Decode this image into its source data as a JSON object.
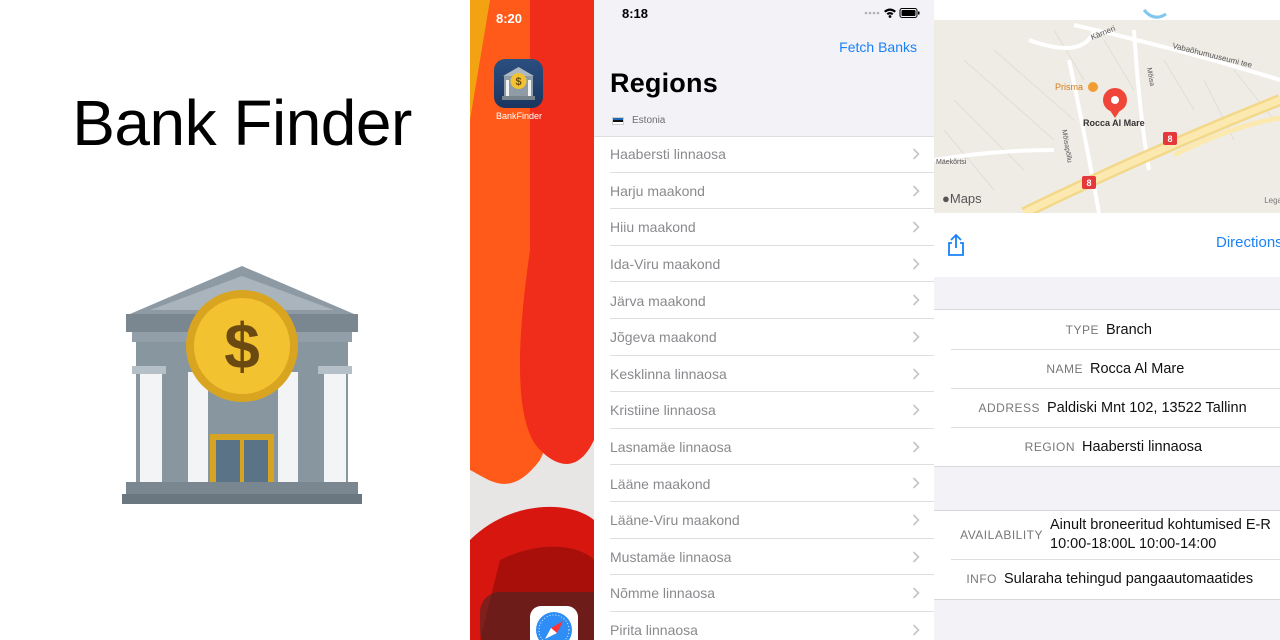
{
  "promo": {
    "title": "Bank Finder",
    "icon": "bank-dollar-icon"
  },
  "home": {
    "time": "8:20",
    "app_label": "BankFinder",
    "dock_app": "safari-icon"
  },
  "regions_screen": {
    "time": "8:18",
    "fetch_button": "Fetch Banks",
    "title": "Regions",
    "section_header": "Estonia",
    "items": [
      "Haabersti linnaosa",
      "Harju maakond",
      "Hiiu maakond",
      "Ida-Viru maakond",
      "Järva maakond",
      "Jõgeva maakond",
      "Kesklinna linnaosa",
      "Kristiine linnaosa",
      "Lasnamäe linnaosa",
      "Lääne maakond",
      "Lääne-Viru maakond",
      "Mustamäe linnaosa",
      "Nõmme linnaosa",
      "Pirita linnaosa"
    ]
  },
  "detail_screen": {
    "map": {
      "pin_label": "Rocca Al Mare",
      "poi_label": "Prisma",
      "streets": [
        "Kärneri",
        "Vabaõhumuuseumi tee",
        "Mõisa",
        "Mõisapõllu",
        "Mäekõrtsi"
      ],
      "road_badge": "8",
      "maps_logo": "Maps",
      "legal": "Lega"
    },
    "directions_button": "Directions",
    "share_icon": "share-icon",
    "rows": {
      "type": {
        "key": "TYPE",
        "value": "Branch"
      },
      "name": {
        "key": "NAME",
        "value": "Rocca Al Mare"
      },
      "address": {
        "key": "ADDRESS",
        "value": "Paldiski Mnt 102, 13522 Tallinn"
      },
      "region": {
        "key": "REGION",
        "value": "Haabersti linnaosa"
      },
      "availability": {
        "key": "AVAILABILITY",
        "value": "Ainult broneeritud kohtumised E-R  10:00-18:00L 10:00-14:00"
      },
      "info": {
        "key": "INFO",
        "value": "Sularaha tehingud pangaautomaatides"
      }
    }
  },
  "colors": {
    "accent": "#1a82f7",
    "pin": "#f0463a",
    "coin": "#f2c230"
  }
}
